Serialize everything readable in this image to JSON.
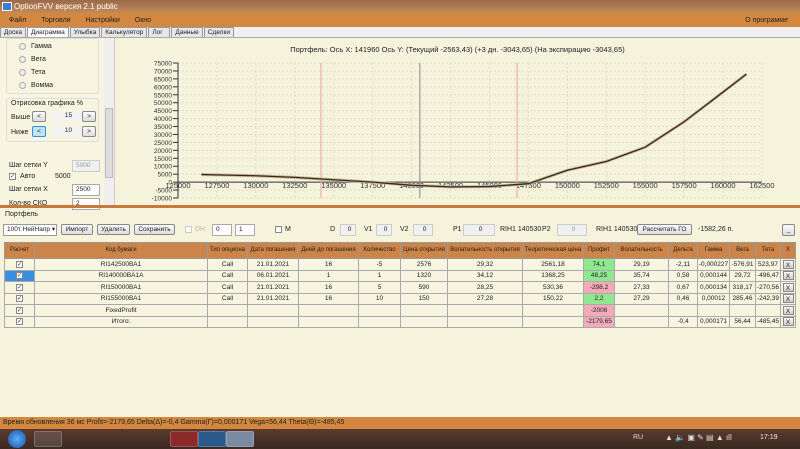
{
  "window": {
    "title": "OptionFVV версия 2.1 public"
  },
  "menu": {
    "items": [
      "Файл",
      "Торговля",
      "Настройки",
      "Окно"
    ],
    "about": "О программе"
  },
  "tabs": [
    {
      "label": "Доска"
    },
    {
      "label": "Диаграмма",
      "active": true
    },
    {
      "label": "Улыбка"
    },
    {
      "label": "Калькулятор"
    },
    {
      "label": "Лог"
    },
    {
      "label": "Данные"
    },
    {
      "label": "Сделки"
    }
  ],
  "left": {
    "radios": [
      "Гамма",
      "Вега",
      "Тета",
      "Вомма"
    ],
    "draw_group": "Отрисовка графика %",
    "above_label": "Выше",
    "above_value": "15",
    "below_label": "Ниже",
    "below_value": "10",
    "dec": "<",
    "inc": ">",
    "grid_y_label": "Шаг сетки Y",
    "grid_y_value": "5000",
    "auto_label": "Авто",
    "auto_checked": true,
    "auto_value": "5000",
    "grid_x_label": "Шаг сетки X",
    "grid_x_value": "2500",
    "sko_label": "Кол-во СКО",
    "sko_value": "2"
  },
  "chart": {
    "header": "Портфель: Ось X:  141960 Ось Y:   (Текущий -2563,43)   (+3 дн. -3043,65)   (На экспирацию -3043,65)",
    "chart_data": {
      "type": "line",
      "xlim": [
        125000,
        162500
      ],
      "ylim": [
        -10000,
        75000
      ],
      "x_ticks": [
        125000,
        127500,
        130000,
        132500,
        135000,
        137500,
        140000,
        142500,
        145000,
        147500,
        150000,
        152500,
        155000,
        157500,
        160000,
        162500
      ],
      "y_ticks": [
        75000,
        70000,
        65000,
        60000,
        55000,
        50000,
        45000,
        40000,
        35000,
        30000,
        25000,
        20000,
        15000,
        10000,
        5000,
        0,
        -5000,
        -10000
      ],
      "grid": true,
      "series": [
        {
          "color": "#3a2a1a",
          "x": [
            126500,
            130000,
            132500,
            135000,
            137500,
            140000,
            142500,
            145000,
            147500,
            150000,
            152500,
            155000,
            157500,
            160000,
            161500
          ],
          "y": [
            4800,
            4000,
            3000,
            1500,
            0,
            -2000,
            -3000,
            -2800,
            -1000,
            7500,
            13000,
            22000,
            38000,
            56700,
            68000
          ]
        }
      ],
      "vlines": [
        {
          "x": 140530,
          "color": "#888888"
        },
        {
          "x": 134180,
          "color": "#f0a0a0"
        },
        {
          "x": 146770,
          "color": "#f0a0a0"
        }
      ]
    }
  },
  "portfolio": {
    "label": "Портфель",
    "select": "100т НейНапр",
    "import": "Импорт",
    "delete": "Удалить",
    "save": "Сохранить",
    "dh": "DH",
    "spin1": "0",
    "spin2": "1",
    "m": "M",
    "d_label": "D",
    "d": "0",
    "v1_label": "V1",
    "v1": "0",
    "v2_label": "V2",
    "v2": "0",
    "p1_label": "P1",
    "p1": "0",
    "rih1": "RIH1 140530",
    "p2_label": "P2",
    "p2": "0",
    "rih2": "RIH1 140530",
    "calc_go": "Рассчитать ГО",
    "go_value": "-1582,26 п.",
    "min": "_"
  },
  "table": {
    "headers": [
      "Расчет",
      "Код бумаги",
      "Тип опциона",
      "Дата погашения",
      "Дней до погашения",
      "Количество",
      "Цена открытия",
      "Волатильность открытия",
      "Теоретическая цена",
      "Профит",
      "Волатильность",
      "Дельта",
      "Гамма",
      "Вега",
      "Тета",
      "X"
    ],
    "rows": [
      {
        "code": "RI142500BA1",
        "type": "Call",
        "date": "21.01.2021",
        "days": "16",
        "qty": "-5",
        "open": "2576",
        "vol_open": "29,32",
        "theo": "2561,18",
        "profit": "74,1",
        "pc": "g",
        "vol": "29,19",
        "delta": "-2,11",
        "gamma": "-0,000227",
        "vega": "-576,91",
        "theta": "523,97"
      },
      {
        "code": "RI140000BA1A",
        "type": "Call",
        "date": "06.01.2021",
        "days": "1",
        "qty": "1",
        "open": "1320",
        "vol_open": "34,12",
        "theo": "1368,25",
        "profit": "48,25",
        "pc": "g",
        "vol": "35,74",
        "delta": "0,58",
        "gamma": "0,000144",
        "vega": "29,72",
        "theta": "-496,47",
        "selected": true
      },
      {
        "code": "RI150000BA1",
        "type": "Call",
        "date": "21.01.2021",
        "days": "16",
        "qty": "5",
        "open": "590",
        "vol_open": "28,25",
        "theo": "530,36",
        "profit": "-298,2",
        "pc": "r",
        "vol": "27,33",
        "delta": "0,67",
        "gamma": "0,000134",
        "vega": "318,17",
        "theta": "-270,56"
      },
      {
        "code": "RI155000BA1",
        "type": "Call",
        "date": "21.01.2021",
        "days": "16",
        "qty": "10",
        "open": "150",
        "vol_open": "27,28",
        "theo": "150,22",
        "profit": "2,2",
        "pc": "g",
        "vol": "27,29",
        "delta": "0,46",
        "gamma": "0,00012",
        "vega": "285,46",
        "theta": "-242,39"
      },
      {
        "code": "FixedProfit",
        "type": "",
        "date": "",
        "days": "",
        "qty": "",
        "open": "",
        "vol_open": "",
        "theo": "",
        "profit": "-2006",
        "pc": "r",
        "vol": "",
        "delta": "",
        "gamma": "",
        "vega": "",
        "theta": ""
      },
      {
        "code": "Итого:",
        "type": "",
        "date": "",
        "days": "",
        "qty": "",
        "open": "",
        "vol_open": "",
        "theo": "",
        "profit": "-2179,65",
        "pc": "r",
        "vol": "",
        "delta": "-0,4",
        "gamma": "0,000171",
        "vega": "56,44",
        "theta": "-485,45"
      }
    ],
    "x_label": "X"
  },
  "status": "Время обновления 36 мс   Profit=-2179,65 Delta(Δ)=-0,4 Gamma(Γ)=0,000171 Vega=56,44 Theta(Θ)=-485,45",
  "taskbar": {
    "lang": "RU",
    "time": "17:19"
  }
}
